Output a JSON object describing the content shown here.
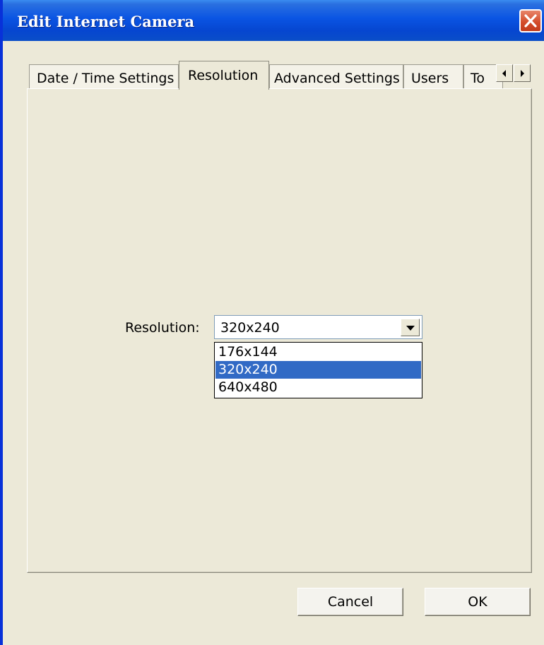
{
  "window": {
    "title": "Edit Internet Camera"
  },
  "tabs": [
    {
      "label": "Date / Time Settings",
      "active": false
    },
    {
      "label": "Resolution",
      "active": true
    },
    {
      "label": "Advanced Settings",
      "active": false
    },
    {
      "label": "Users",
      "active": false
    },
    {
      "label": "To",
      "active": false
    }
  ],
  "resolution": {
    "label": "Resolution:",
    "selected": "320x240",
    "options": [
      "176x144",
      "320x240",
      "640x480"
    ],
    "highlighted_option": "320x240"
  },
  "buttons": {
    "cancel": "Cancel",
    "ok": "OK"
  },
  "colors": {
    "titlebar": "#0a54e3",
    "highlight": "#316ac5",
    "close_button": "#d24a28",
    "dialog_bg": "#ece9d8"
  },
  "icons": {
    "close": "close-x-icon",
    "tab_left": "arrow-left-icon",
    "tab_right": "arrow-right-icon",
    "dropdown": "chevron-down-icon"
  }
}
